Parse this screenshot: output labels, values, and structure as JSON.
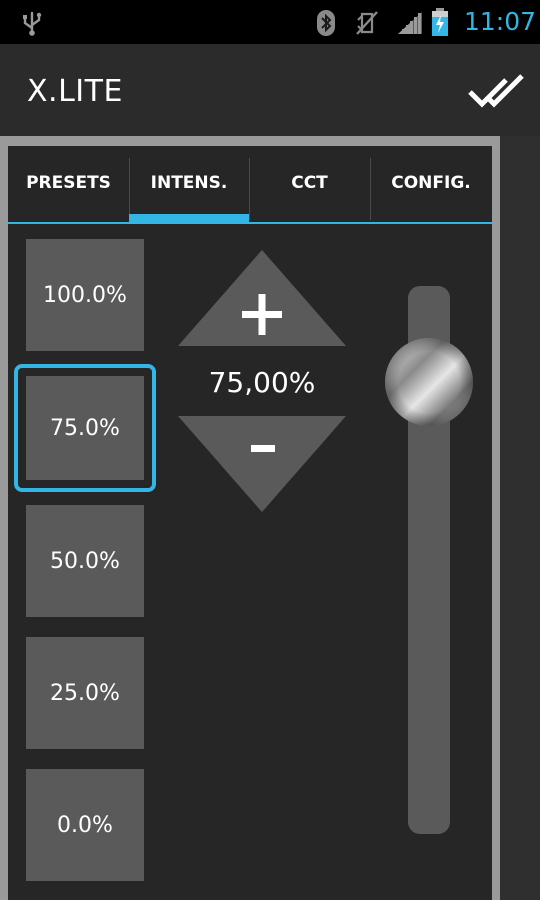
{
  "status_bar": {
    "time": "11:07",
    "icons": [
      "usb-icon",
      "bluetooth-icon",
      "mute-icon",
      "signal-icon",
      "battery-charging-icon"
    ],
    "accent_color": "#33b5e5"
  },
  "action_bar": {
    "title": "X.LITE",
    "done_icon": "done-all-icon"
  },
  "tabs": [
    {
      "label": "PRESETS",
      "active": false
    },
    {
      "label": "INTENS.",
      "active": true
    },
    {
      "label": "CCT",
      "active": false
    },
    {
      "label": "CONFIG.",
      "active": false
    }
  ],
  "presets": [
    {
      "label": "100.0%",
      "selected": false
    },
    {
      "label": "75.0%",
      "selected": true
    },
    {
      "label": "50.0%",
      "selected": false
    },
    {
      "label": "25.0%",
      "selected": false
    },
    {
      "label": "0.0%",
      "selected": false
    }
  ],
  "intensity": {
    "value_label": "75,00%",
    "increase_symbol": "+",
    "decrease_symbol": "-",
    "slider_level": 0.75
  },
  "colors": {
    "accent": "#33b5e5",
    "button": "#5a5a5a",
    "background": "#262626"
  }
}
